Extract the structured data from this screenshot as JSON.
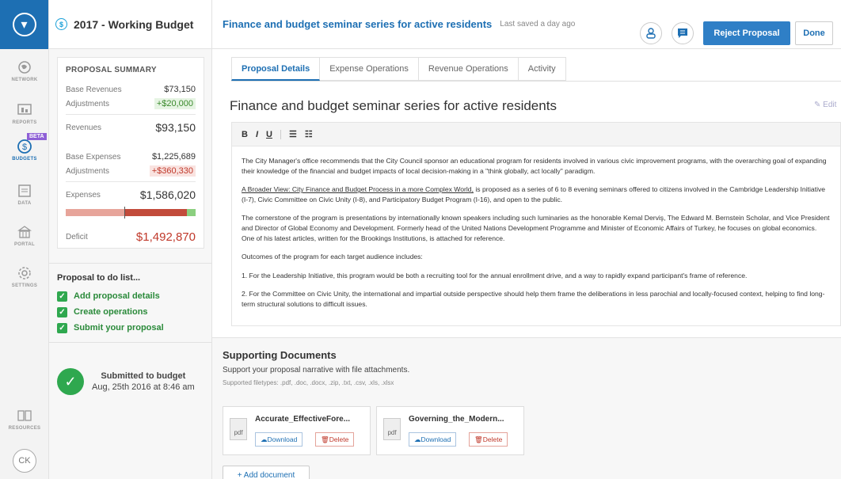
{
  "rail": {
    "items": [
      {
        "label": "NETWORK"
      },
      {
        "label": "REPORTS"
      },
      {
        "label": "BUDGETS",
        "badge": "BETA"
      },
      {
        "label": "DATA"
      },
      {
        "label": "PORTAL"
      },
      {
        "label": "SETTINGS"
      },
      {
        "label": "RESOURCES"
      }
    ],
    "avatar": "CK"
  },
  "budget": {
    "title": "2017 - Working Budget",
    "summary": {
      "heading": "PROPOSAL SUMMARY",
      "base_revenues_label": "Base Revenues",
      "base_revenues": "$73,150",
      "rev_adj_label": "Adjustments",
      "rev_adj": "+$20,000",
      "revenues_label": "Revenues",
      "revenues": "$93,150",
      "base_expenses_label": "Base Expenses",
      "base_expenses": "$1,225,689",
      "exp_adj_label": "Adjustments",
      "exp_adj": "+$360,330",
      "expenses_label": "Expenses",
      "expenses": "$1,586,020",
      "deficit_label": "Deficit",
      "deficit": "$1,492,870"
    },
    "todo": {
      "heading": "Proposal to do list...",
      "items": [
        "Add proposal details",
        "Create operations",
        "Submit your proposal"
      ]
    },
    "submitted": {
      "line1": "Submitted to budget",
      "line2": "Aug, 25th 2016 at 8:46 am"
    }
  },
  "header": {
    "title": "Finance and budget seminar series for active residents",
    "saved": "Last saved a day ago",
    "reject_label": "Reject Proposal",
    "done_label": "Done"
  },
  "tabs": [
    "Proposal Details",
    "Expense Operations",
    "Revenue Operations",
    "Activity"
  ],
  "proposal": {
    "title": "Finance and budget seminar series for active residents",
    "edit_label": "Edit",
    "paragraphs": [
      "The City Manager's office recommends that the City Council sponsor an educational program for residents involved in various civic improvement programs, with the overarching goal of expanding their knowledge of the financial and budget impacts of local decision-making in a \"think globally, act locally\" paradigm.",
      "is proposed as a series of 6 to 8 evening seminars offered to citizens involved in the Cambridge Leadership Initiative (I-7), Civic Committee on Civic Unity (I-8), and Participatory Budget Program (I-16), and open to the public.",
      "The cornerstone of the program is presentations by internationally known speakers including such luminaries as the honorable Kemal Derviş, The Edward M. Bernstein Scholar, and Vice President and Director of Global Economy and Development. Formerly head of the United Nations Development Programme and Minister of Economic Affairs of Turkey, he focuses on global economics. One of his latest articles, written for the Brookings Institutions, is attached for reference.",
      "Outcomes of the program for each target audience includes:",
      "1.   For the Leadership Initiative, this program would be both a recruiting tool for the annual enrollment drive, and a way to rapidly expand participant's frame of reference.",
      "2.   For the Committee on Civic Unity, the international and impartial outside perspective should help them frame the deliberations in less parochial and locally-focused context, helping to find long-term structural solutions to difficult issues."
    ],
    "link_text": "A Broader View: City Finance and Budget Process in a more Complex World,"
  },
  "supporting": {
    "title": "Supporting Documents",
    "subtitle": "Support your proposal narrative with file attachments.",
    "types": "Supported filetypes: .pdf, .doc, .docx, .zip, .txt, .csv, .xls, .xlsx",
    "docs": [
      {
        "ext": "pdf",
        "name": "Accurate_EffectiveFore...",
        "download": "Download",
        "delete": "Delete"
      },
      {
        "ext": "pdf",
        "name": "Governing_the_Modern...",
        "download": "Download",
        "delete": "Delete"
      }
    ],
    "add_label": "+ Add document"
  }
}
